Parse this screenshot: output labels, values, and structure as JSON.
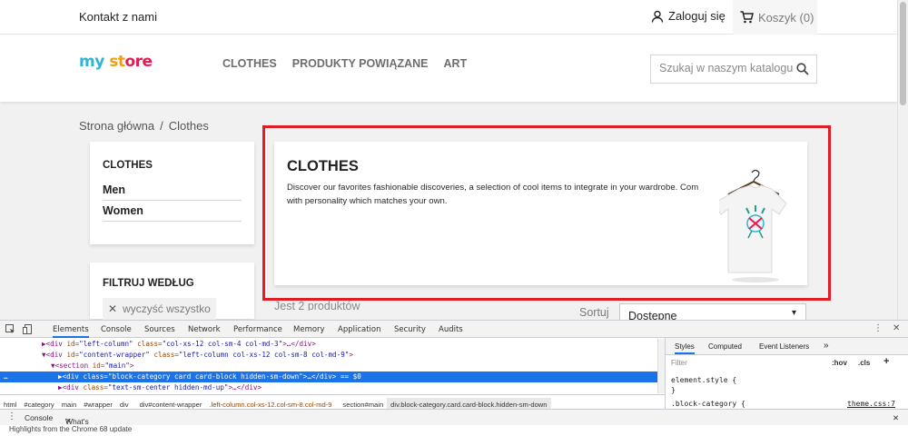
{
  "topbar": {
    "contact": "Kontakt z nami",
    "login": "Zaloguj się",
    "cart": "Koszyk (0)"
  },
  "header": {
    "logo_part1": "my",
    "logo_part2": "st",
    "logo_part3": "ore",
    "nav": [
      "CLOTHES",
      "PRODUKTY POWIĄZANE",
      "ART"
    ],
    "search_placeholder": "Szukaj w naszym katalogu"
  },
  "breadcrumb": {
    "home": "Strona główna",
    "separator": "/",
    "current": "Clothes"
  },
  "sidebar": {
    "category_title": "CLOTHES",
    "subcategories": [
      "Men",
      "Women"
    ],
    "filter_title": "FILTRUJ WEDŁUG",
    "clear_all": "wyczyść wszystko"
  },
  "category": {
    "title": "CLOTHES",
    "description": "Discover our favorites fashionable discoveries, a selection of cool items to integrate in your wardrobe. Com\nwith personality which matches your own."
  },
  "listing": {
    "count": "Jest 2 produktów",
    "sort_label": "Sortuj",
    "sort_value": "Dostępne"
  },
  "colors": {
    "accent": "#2fb5d2",
    "highlight_border": "#e01c24",
    "devtools_selection": "#1a73e8"
  },
  "devtools": {
    "tabs": [
      "Elements",
      "Console",
      "Sources",
      "Network",
      "Performance",
      "Memory",
      "Application",
      "Security",
      "Audits"
    ],
    "active_tab": "Elements",
    "dom_lines": [
      {
        "prefix": "▶",
        "tag_open": "<div ",
        "a1": "id=",
        "v1": "\"left-column\" ",
        "a2": "class=",
        "v2": "\"col-xs-12 col-sm-4 col-md-3\"",
        "rest": ">…</div>"
      },
      {
        "prefix": "▼",
        "tag_open": "<div ",
        "a1": "id=",
        "v1": "\"content-wrapper\" ",
        "a2": "class=",
        "v2": "\"left-column col-xs-12 col-sm-8 col-md-9\"",
        "rest": ">"
      },
      {
        "prefix": "▼",
        "tag_open": "<section ",
        "a1": "id=",
        "v1": "\"main\"",
        "a2": "",
        "v2": "",
        "rest": ">"
      },
      {
        "prefix": "▶",
        "tag_open": "<div ",
        "a1": "class=",
        "v1": "\"block-category card card-block hidden-sm-down\"",
        "a2": "",
        "v2": "",
        "rest": ">…</div> == $0"
      },
      {
        "prefix": "▶",
        "tag_open": "<div ",
        "a1": "class=",
        "v1": "\"text-sm-center hidden-md-up\"",
        "a2": "",
        "v2": "",
        "rest": ">…</div>"
      }
    ],
    "dom_ellipsis": "…",
    "crumbs": [
      {
        "tag": "html",
        "cls": ""
      },
      {
        "tag": "#category",
        "cls": ""
      },
      {
        "tag": "main",
        "cls": ""
      },
      {
        "tag": "#wrapper",
        "cls": ""
      },
      {
        "tag": "div",
        "cls": ""
      },
      {
        "tag": "div#content-wrapper",
        "cls": ".left-column.col-xs-12.col-sm-8.col-md-9"
      },
      {
        "tag": "section#main",
        "cls": ""
      },
      {
        "tag": "div.block-category.card.card-block.hidden-sm-down",
        "cls": ""
      }
    ],
    "styles_tabs": [
      "Styles",
      "Computed",
      "Event Listeners"
    ],
    "styles_more": "»",
    "filter_placeholder": "Filter",
    "hov": ":hov",
    "cls": ".cls",
    "plus": "+",
    "rules": [
      "element.style {",
      "}",
      ".block-category {"
    ],
    "rule_source": "theme.css:7",
    "drawer_tabs": [
      "Console",
      "What's New"
    ],
    "drawer_message": "Highlights from the Chrome 68 update"
  }
}
